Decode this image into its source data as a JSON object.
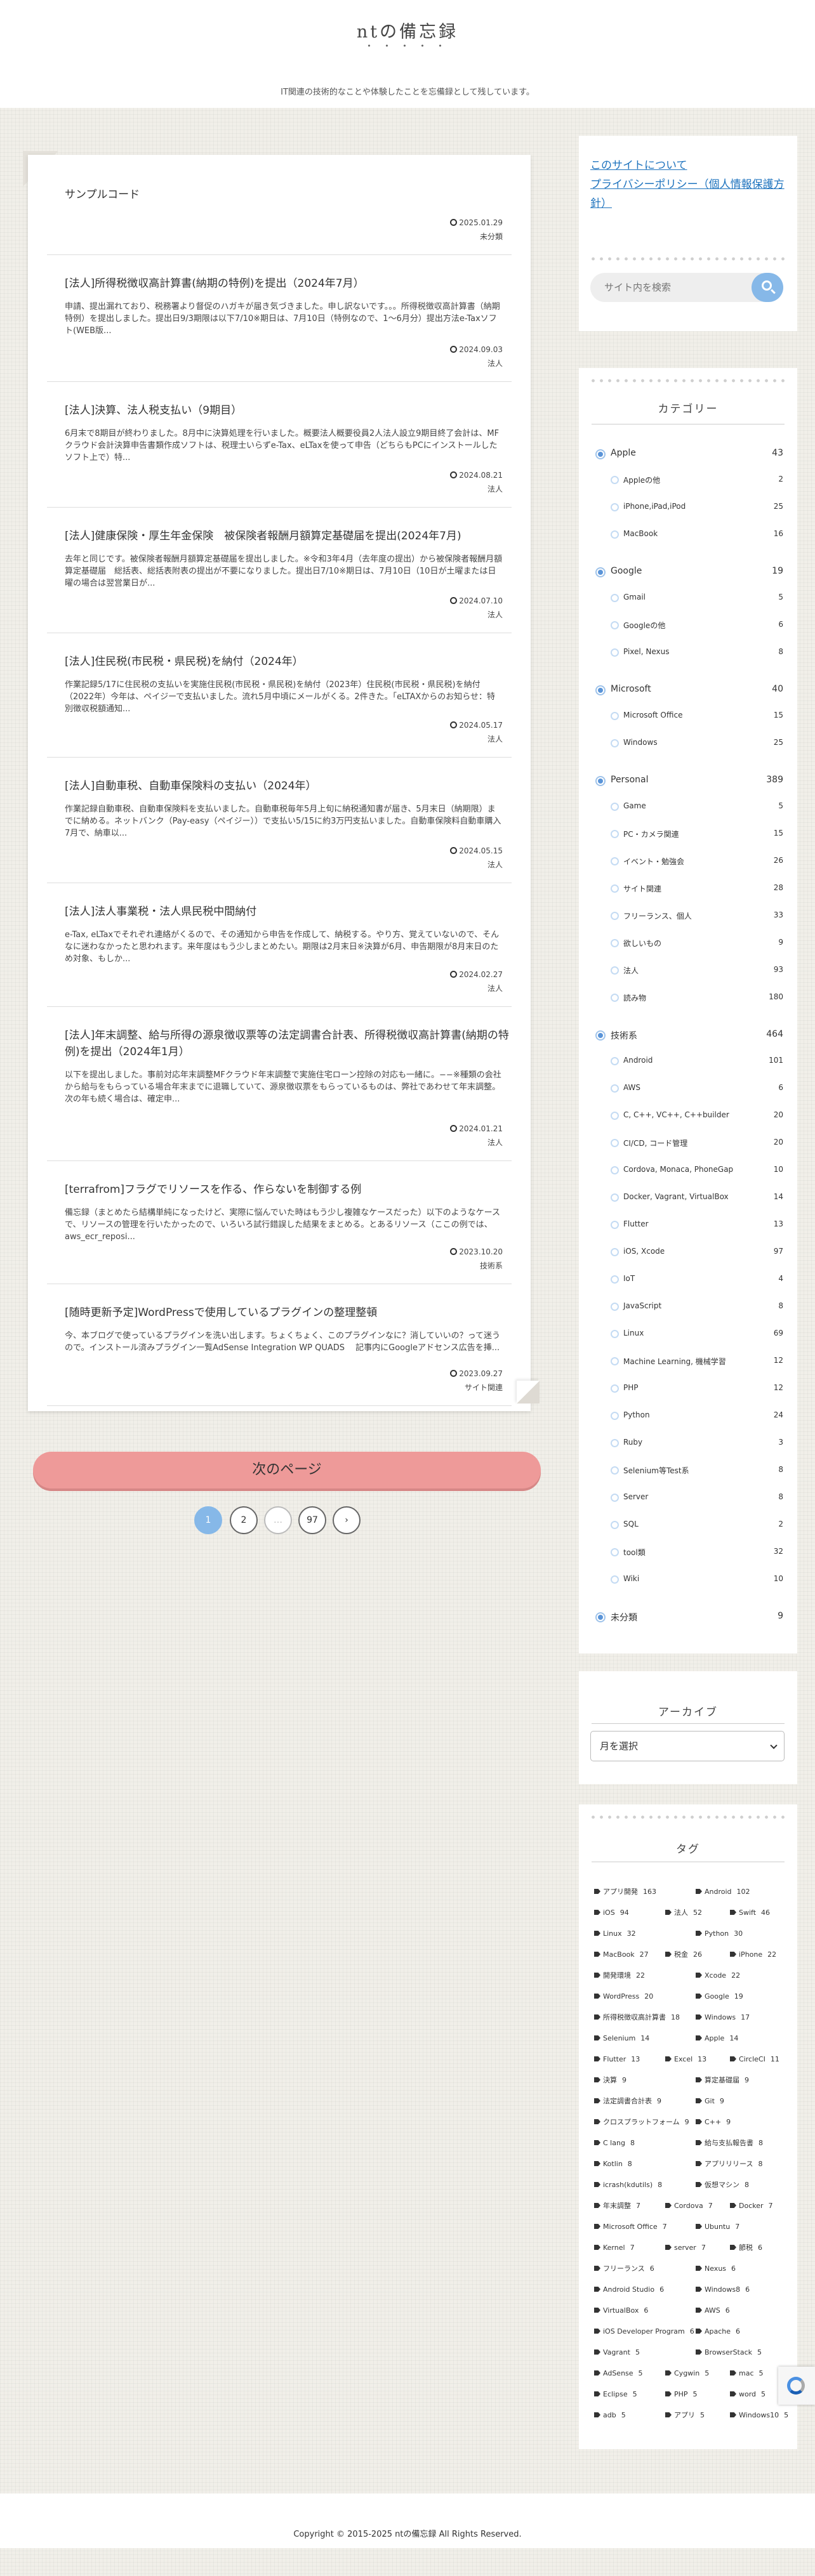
{
  "header": {
    "site_title": "ntの備忘録",
    "tagline": "IT関連の技術的なことや体験したことを忘備録として残しています。"
  },
  "posts": [
    {
      "title": "サンプルコード",
      "excerpt": "",
      "date": "2025.01.29",
      "category": "未分類"
    },
    {
      "title": "[法人]所得税徴収高計算書(納期の特例)を提出（2024年7月）",
      "excerpt": "申請、提出漏れており、税務署より督促のハガキが届き気づきました。申し訳ないです。。。所得税徴収高計算書（納期特例）を提出しました。提出日9/3期限は以下7/10※期日は、7月10日（特例なので、1〜6月分）提出方法e-Taxソフト(WEB版...",
      "date": "2024.09.03",
      "category": "法人"
    },
    {
      "title": "[法人]決算、法人税支払い（9期目）",
      "excerpt": "6月末で8期目が終わりました。8月中に決算処理を行いました。概要法人概要役員2人法人設立9期目終了会計は、MFクラウド会計決算申告書類作成ソフトは、税理士いらずe-Tax、eLTaxを使って申告（どちらもPCにインストールしたソフト上で）特...",
      "date": "2024.08.21",
      "category": "法人"
    },
    {
      "title": "[法人]健康保険・厚生年金保険　被保険者報酬月額算定基礎届を提出(2024年7月)",
      "excerpt": "去年と同じです。被保険者報酬月額算定基礎届を提出しました。※令和3年4月（去年度の提出）から被保険者報酬月額算定基礎届　総括表、総括表附表の提出が不要になりました。提出日7/10※期日は、7月10日（10日が土曜または日曜の場合は翌営業日が...",
      "date": "2024.07.10",
      "category": "法人"
    },
    {
      "title": "[法人]住民税(市民税・県民税)を納付（2024年）",
      "excerpt": "作業記録5/17に住民税の支払いを実施住民税(市民税・県民税)を納付（2023年）住民税(市民税・県民税)を納付（2022年）今年は、ペイジーで支払いました。流れ5月中頃にメールがくる。2件きた。「eLTAXからのお知らせ：特別徴収税額通知...",
      "date": "2024.05.17",
      "category": "法人"
    },
    {
      "title": "[法人]自動車税、自動車保険料の支払い（2024年）",
      "excerpt": "作業記録自動車税、自動車保険料を支払いました。自動車税毎年5月上旬に納税通知書が届き、5月末日（納期限）までに納める。ネットバンク（Pay-easy（ペイジー））で支払い5/15に約3万円支払いました。自動車保険料自動車購入7月で、納車以...",
      "date": "2024.05.15",
      "category": "法人"
    },
    {
      "title": "[法人]法人事業税・法人県民税中間納付",
      "excerpt": "e-Tax, eLTaxでそれぞれ連絡がくるので、その通知から申告を作成して、納税する。やり方、覚えていないので、そんなに迷わなかったと思われます。来年度はもう少しまとめたい。期限は2月末日※決算が6月、申告期限が8月末日のため対象、もしか...",
      "date": "2024.02.27",
      "category": "法人"
    },
    {
      "title": "[法人]年末調整、給与所得の源泉徴収票等の法定調書合計表、所得税徴収高計算書(納期の特例)を提出（2024年1月）",
      "excerpt": "以下を提出しました。事前対応年末調整MFクラウド年末調整で実施住宅ローン控除の対応も一緒に。−−※種類の会社から給与をもらっている場合年末までに退職していて、源泉徴収票をもらっているものは、弊社であわせて年末調整。次の年も続く場合は、確定申...",
      "date": "2024.01.21",
      "category": "法人"
    },
    {
      "title": "[terrafrom]フラグでリソースを作る、作らないを制御する例",
      "excerpt": "備忘録（まとめたら結構単純になったけど、実際に悩んでいた時はもう少し複雑なケースだった）以下のようなケースで、リソースの管理を行いたかったので、いろいろ試行錯誤した結果をまとめる。とあるリソース（ここの例では、aws_ecr_reposi...",
      "date": "2023.10.20",
      "category": "技術系"
    },
    {
      "title": "[随時更新予定]WordPressで使用しているプラグインの整理整頓",
      "excerpt": "今、本ブログで使っているプラグインを洗い出します。ちょくちょく、このプラグインなに？消していいの？って迷うので。インストール済みプラグイン一覧AdSense Integration WP QUADS　 記事内にGoogleアドセンス広告を挿...",
      "date": "2023.09.27",
      "category": "サイト関連"
    }
  ],
  "pagination": {
    "next_label": "次のページ",
    "pages": [
      "1",
      "2",
      "…",
      "97",
      "›"
    ]
  },
  "sidebar": {
    "links": [
      "このサイトについて",
      "プライバシーポリシー（個人情報保護方針）"
    ],
    "search_placeholder": "サイト内を検索",
    "category_title": "カテゴリー",
    "categories": [
      {
        "name": "Apple",
        "count": "43",
        "level": 0
      },
      {
        "name": "Appleの他",
        "count": "2",
        "level": 1
      },
      {
        "name": "iPhone,iPad,iPod",
        "count": "25",
        "level": 1
      },
      {
        "name": "MacBook",
        "count": "16",
        "level": 1
      },
      {
        "name": "Google",
        "count": "19",
        "level": 0
      },
      {
        "name": "Gmail",
        "count": "5",
        "level": 1
      },
      {
        "name": "Googleの他",
        "count": "6",
        "level": 1
      },
      {
        "name": "Pixel, Nexus",
        "count": "8",
        "level": 1
      },
      {
        "name": "Microsoft",
        "count": "40",
        "level": 0
      },
      {
        "name": "Microsoft Office",
        "count": "15",
        "level": 1
      },
      {
        "name": "Windows",
        "count": "25",
        "level": 1
      },
      {
        "name": "Personal",
        "count": "389",
        "level": 0
      },
      {
        "name": "Game",
        "count": "5",
        "level": 1
      },
      {
        "name": "PC・カメラ関連",
        "count": "15",
        "level": 1
      },
      {
        "name": "イベント・勉強会",
        "count": "26",
        "level": 1
      },
      {
        "name": "サイト関連",
        "count": "28",
        "level": 1
      },
      {
        "name": "フリーランス、個人",
        "count": "33",
        "level": 1
      },
      {
        "name": "欲しいもの",
        "count": "9",
        "level": 1
      },
      {
        "name": "法人",
        "count": "93",
        "level": 1
      },
      {
        "name": "読み物",
        "count": "180",
        "level": 1
      },
      {
        "name": "技術系",
        "count": "464",
        "level": 0
      },
      {
        "name": "Android",
        "count": "101",
        "level": 1
      },
      {
        "name": "AWS",
        "count": "6",
        "level": 1
      },
      {
        "name": "C, C++, VC++, C++builder",
        "count": "20",
        "level": 1
      },
      {
        "name": "CI/CD, コード管理",
        "count": "20",
        "level": 1
      },
      {
        "name": "Cordova, Monaca, PhoneGap",
        "count": "10",
        "level": 1
      },
      {
        "name": "Docker, Vagrant, VirtualBox",
        "count": "14",
        "level": 1
      },
      {
        "name": "Flutter",
        "count": "13",
        "level": 1
      },
      {
        "name": "iOS, Xcode",
        "count": "97",
        "level": 1
      },
      {
        "name": "IoT",
        "count": "4",
        "level": 1
      },
      {
        "name": "JavaScript",
        "count": "8",
        "level": 1
      },
      {
        "name": "Linux",
        "count": "69",
        "level": 1
      },
      {
        "name": "Machine Learning, 機械学習",
        "count": "12",
        "level": 1
      },
      {
        "name": "PHP",
        "count": "12",
        "level": 1
      },
      {
        "name": "Python",
        "count": "24",
        "level": 1
      },
      {
        "name": "Ruby",
        "count": "3",
        "level": 1
      },
      {
        "name": "Selenium等Test系",
        "count": "8",
        "level": 1
      },
      {
        "name": "Server",
        "count": "8",
        "level": 1
      },
      {
        "name": "SQL",
        "count": "2",
        "level": 1
      },
      {
        "name": "tool類",
        "count": "32",
        "level": 1
      },
      {
        "name": "Wiki",
        "count": "10",
        "level": 1
      },
      {
        "name": "未分類",
        "count": "9",
        "level": 0
      }
    ],
    "archive_title": "アーカイブ",
    "archive_select": "月を選択",
    "tag_title": "タグ",
    "tags": [
      [
        "アプリ開発",
        "163",
        "Android",
        "102"
      ],
      [
        "iOS",
        "94",
        "法人",
        "52",
        "Swift",
        "46"
      ],
      [
        "Linux",
        "32",
        "Python",
        "30"
      ],
      [
        "MacBook",
        "27",
        "税金",
        "26",
        "iPhone",
        "22"
      ],
      [
        "開発環境",
        "22",
        "Xcode",
        "22"
      ],
      [
        "WordPress",
        "20",
        "Google",
        "19"
      ],
      [
        "所得税徴収高計算書",
        "18",
        "Windows",
        "17"
      ],
      [
        "Selenium",
        "14",
        "Apple",
        "14"
      ],
      [
        "Flutter",
        "13",
        "Excel",
        "13",
        "CircleCI",
        "11"
      ],
      [
        "決算",
        "9",
        "算定基礎届",
        "9"
      ],
      [
        "法定調書合計表",
        "9",
        "Git",
        "9"
      ],
      [
        "クロスプラットフォーム",
        "9",
        "C++",
        "9"
      ],
      [
        "C lang",
        "8",
        "給与支払報告書",
        "8"
      ],
      [
        "Kotlin",
        "8",
        "アプリリリース",
        "8"
      ],
      [
        "icrash(kdutils)",
        "8",
        "仮想マシン",
        "8"
      ],
      [
        "年末調整",
        "7",
        "Cordova",
        "7",
        "Docker",
        "7"
      ],
      [
        "Microsoft Office",
        "7",
        "Ubuntu",
        "7"
      ],
      [
        "Kernel",
        "7",
        "server",
        "7",
        "節税",
        "6"
      ],
      [
        "フリーランス",
        "6",
        "Nexus",
        "6"
      ],
      [
        "Android Studio",
        "6",
        "Windows8",
        "6"
      ],
      [
        "VirtualBox",
        "6",
        "AWS",
        "6"
      ],
      [
        "iOS Developer Program",
        "6",
        "Apache",
        "6"
      ],
      [
        "Vagrant",
        "5",
        "BrowserStack",
        "5"
      ],
      [
        "AdSense",
        "5",
        "Cygwin",
        "5",
        "mac",
        "5"
      ],
      [
        "Eclipse",
        "5",
        "PHP",
        "5",
        "word",
        "5"
      ],
      [
        "adb",
        "5",
        "アプリ",
        "5",
        "Windows10",
        "5"
      ]
    ]
  },
  "footer": {
    "copyright": "Copyright © 2015-2025 ntの備忘録 All Rights Reserved."
  },
  "colors": {
    "accent_blue": "#86b8e8",
    "next_button": "#ee9a99",
    "link": "#1e73be"
  }
}
